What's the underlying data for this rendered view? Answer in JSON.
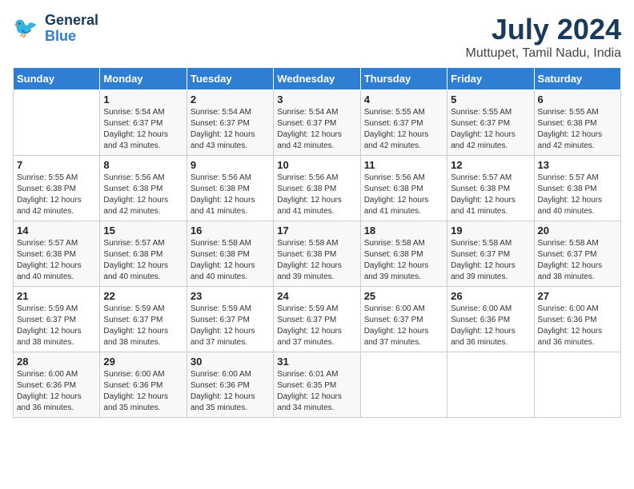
{
  "header": {
    "logo_line1": "General",
    "logo_line2": "Blue",
    "title": "July 2024",
    "subtitle": "Muttupet, Tamil Nadu, India"
  },
  "days_of_week": [
    "Sunday",
    "Monday",
    "Tuesday",
    "Wednesday",
    "Thursday",
    "Friday",
    "Saturday"
  ],
  "weeks": [
    [
      {
        "day": "",
        "info": ""
      },
      {
        "day": "1",
        "info": "Sunrise: 5:54 AM\nSunset: 6:37 PM\nDaylight: 12 hours\nand 43 minutes."
      },
      {
        "day": "2",
        "info": "Sunrise: 5:54 AM\nSunset: 6:37 PM\nDaylight: 12 hours\nand 43 minutes."
      },
      {
        "day": "3",
        "info": "Sunrise: 5:54 AM\nSunset: 6:37 PM\nDaylight: 12 hours\nand 42 minutes."
      },
      {
        "day": "4",
        "info": "Sunrise: 5:55 AM\nSunset: 6:37 PM\nDaylight: 12 hours\nand 42 minutes."
      },
      {
        "day": "5",
        "info": "Sunrise: 5:55 AM\nSunset: 6:37 PM\nDaylight: 12 hours\nand 42 minutes."
      },
      {
        "day": "6",
        "info": "Sunrise: 5:55 AM\nSunset: 6:38 PM\nDaylight: 12 hours\nand 42 minutes."
      }
    ],
    [
      {
        "day": "7",
        "info": "Sunrise: 5:55 AM\nSunset: 6:38 PM\nDaylight: 12 hours\nand 42 minutes."
      },
      {
        "day": "8",
        "info": "Sunrise: 5:56 AM\nSunset: 6:38 PM\nDaylight: 12 hours\nand 42 minutes."
      },
      {
        "day": "9",
        "info": "Sunrise: 5:56 AM\nSunset: 6:38 PM\nDaylight: 12 hours\nand 41 minutes."
      },
      {
        "day": "10",
        "info": "Sunrise: 5:56 AM\nSunset: 6:38 PM\nDaylight: 12 hours\nand 41 minutes."
      },
      {
        "day": "11",
        "info": "Sunrise: 5:56 AM\nSunset: 6:38 PM\nDaylight: 12 hours\nand 41 minutes."
      },
      {
        "day": "12",
        "info": "Sunrise: 5:57 AM\nSunset: 6:38 PM\nDaylight: 12 hours\nand 41 minutes."
      },
      {
        "day": "13",
        "info": "Sunrise: 5:57 AM\nSunset: 6:38 PM\nDaylight: 12 hours\nand 40 minutes."
      }
    ],
    [
      {
        "day": "14",
        "info": "Sunrise: 5:57 AM\nSunset: 6:38 PM\nDaylight: 12 hours\nand 40 minutes."
      },
      {
        "day": "15",
        "info": "Sunrise: 5:57 AM\nSunset: 6:38 PM\nDaylight: 12 hours\nand 40 minutes."
      },
      {
        "day": "16",
        "info": "Sunrise: 5:58 AM\nSunset: 6:38 PM\nDaylight: 12 hours\nand 40 minutes."
      },
      {
        "day": "17",
        "info": "Sunrise: 5:58 AM\nSunset: 6:38 PM\nDaylight: 12 hours\nand 39 minutes."
      },
      {
        "day": "18",
        "info": "Sunrise: 5:58 AM\nSunset: 6:38 PM\nDaylight: 12 hours\nand 39 minutes."
      },
      {
        "day": "19",
        "info": "Sunrise: 5:58 AM\nSunset: 6:37 PM\nDaylight: 12 hours\nand 39 minutes."
      },
      {
        "day": "20",
        "info": "Sunrise: 5:58 AM\nSunset: 6:37 PM\nDaylight: 12 hours\nand 38 minutes."
      }
    ],
    [
      {
        "day": "21",
        "info": "Sunrise: 5:59 AM\nSunset: 6:37 PM\nDaylight: 12 hours\nand 38 minutes."
      },
      {
        "day": "22",
        "info": "Sunrise: 5:59 AM\nSunset: 6:37 PM\nDaylight: 12 hours\nand 38 minutes."
      },
      {
        "day": "23",
        "info": "Sunrise: 5:59 AM\nSunset: 6:37 PM\nDaylight: 12 hours\nand 37 minutes."
      },
      {
        "day": "24",
        "info": "Sunrise: 5:59 AM\nSunset: 6:37 PM\nDaylight: 12 hours\nand 37 minutes."
      },
      {
        "day": "25",
        "info": "Sunrise: 6:00 AM\nSunset: 6:37 PM\nDaylight: 12 hours\nand 37 minutes."
      },
      {
        "day": "26",
        "info": "Sunrise: 6:00 AM\nSunset: 6:36 PM\nDaylight: 12 hours\nand 36 minutes."
      },
      {
        "day": "27",
        "info": "Sunrise: 6:00 AM\nSunset: 6:36 PM\nDaylight: 12 hours\nand 36 minutes."
      }
    ],
    [
      {
        "day": "28",
        "info": "Sunrise: 6:00 AM\nSunset: 6:36 PM\nDaylight: 12 hours\nand 36 minutes."
      },
      {
        "day": "29",
        "info": "Sunrise: 6:00 AM\nSunset: 6:36 PM\nDaylight: 12 hours\nand 35 minutes."
      },
      {
        "day": "30",
        "info": "Sunrise: 6:00 AM\nSunset: 6:36 PM\nDaylight: 12 hours\nand 35 minutes."
      },
      {
        "day": "31",
        "info": "Sunrise: 6:01 AM\nSunset: 6:35 PM\nDaylight: 12 hours\nand 34 minutes."
      },
      {
        "day": "",
        "info": ""
      },
      {
        "day": "",
        "info": ""
      },
      {
        "day": "",
        "info": ""
      }
    ]
  ]
}
